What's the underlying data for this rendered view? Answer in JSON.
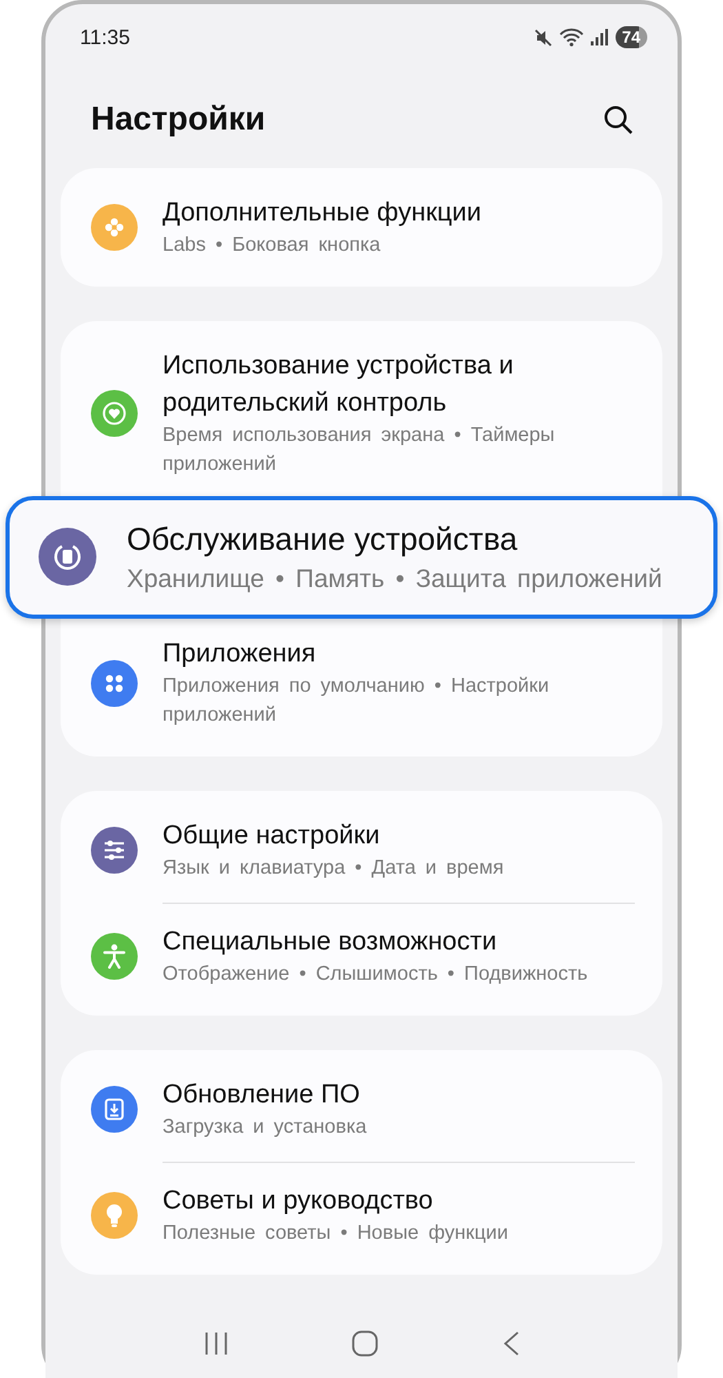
{
  "status_bar": {
    "time": "11:35",
    "battery": "74"
  },
  "header": {
    "title": "Настройки"
  },
  "groups": [
    {
      "items": [
        {
          "title": "Дополнительные функции",
          "subtitle": "Labs • Боковая кнопка",
          "color": "#f7b54a",
          "highlighted": false
        }
      ]
    },
    {
      "items": [
        {
          "title": "Использование устройства и родительский контроль",
          "subtitle": "Время использования экрана • Таймеры приложений",
          "color": "#5cbf45",
          "highlighted": false
        },
        {
          "title": "Обслуживание устройства",
          "subtitle": "Хранилище • Память • Защита приложений",
          "color": "#6a66a3",
          "highlighted": true
        },
        {
          "title": "Приложения",
          "subtitle": "Приложения по умолчанию • Настройки приложений",
          "color": "#3f7cf0",
          "highlighted": false
        }
      ]
    },
    {
      "items": [
        {
          "title": "Общие настройки",
          "subtitle": "Язык и клавиатура • Дата и время",
          "color": "#6a66a3",
          "highlighted": false
        },
        {
          "title": "Специальные возможности",
          "subtitle": "Отображение • Слышимость • Подвижность",
          "color": "#5cbf45",
          "highlighted": false
        }
      ]
    },
    {
      "items": [
        {
          "title": "Обновление ПО",
          "subtitle": "Загрузка и установка",
          "color": "#3f7cf0",
          "highlighted": false
        },
        {
          "title": "Советы и руководство",
          "subtitle": "Полезные советы • Новые функции",
          "color": "#f7b54a",
          "highlighted": false
        }
      ]
    }
  ]
}
